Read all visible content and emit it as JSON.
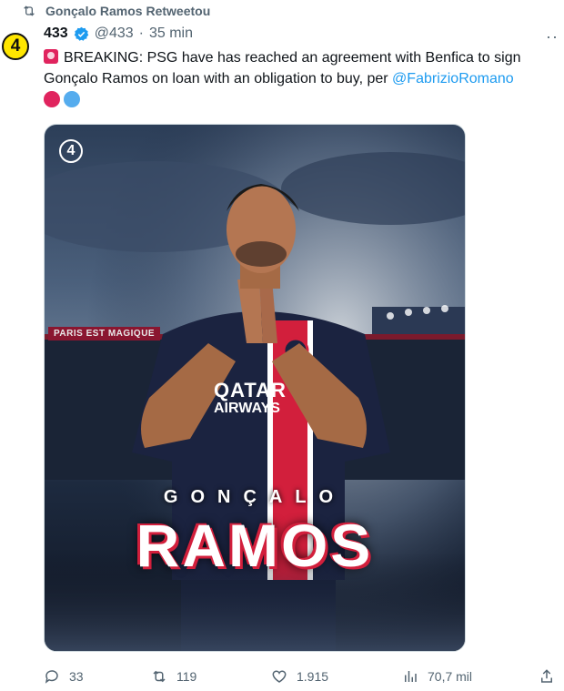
{
  "retweet": {
    "label": "Gonçalo Ramos Retweetou"
  },
  "tweet": {
    "avatar_text": "4",
    "name": "433",
    "handle": "@433",
    "separator": "·",
    "time": "35 min",
    "text_main": "BREAKING: PSG have has reached an agreement with Benfica to sign Gonçalo Ramos on loan with an obligation to buy, per ",
    "mention": "@FabrizioRomano",
    "emoji_circles": [
      "#e0245e",
      "#55acee"
    ]
  },
  "media": {
    "badge": "4",
    "banner": "PARIS EST MAGIQUE",
    "sponsor_line1": "QATAR",
    "sponsor_line2": "AIRWAYS",
    "first_name": "GONÇALO",
    "last_name": "RAMOS"
  },
  "actions": {
    "replies": "33",
    "retweets": "119",
    "likes": "1.915",
    "views": "70,7 mil"
  },
  "colors": {
    "accent": "#1d9bf0",
    "muted": "#536471",
    "psg_red": "#d21f3c",
    "psg_navy": "#1b2340"
  }
}
